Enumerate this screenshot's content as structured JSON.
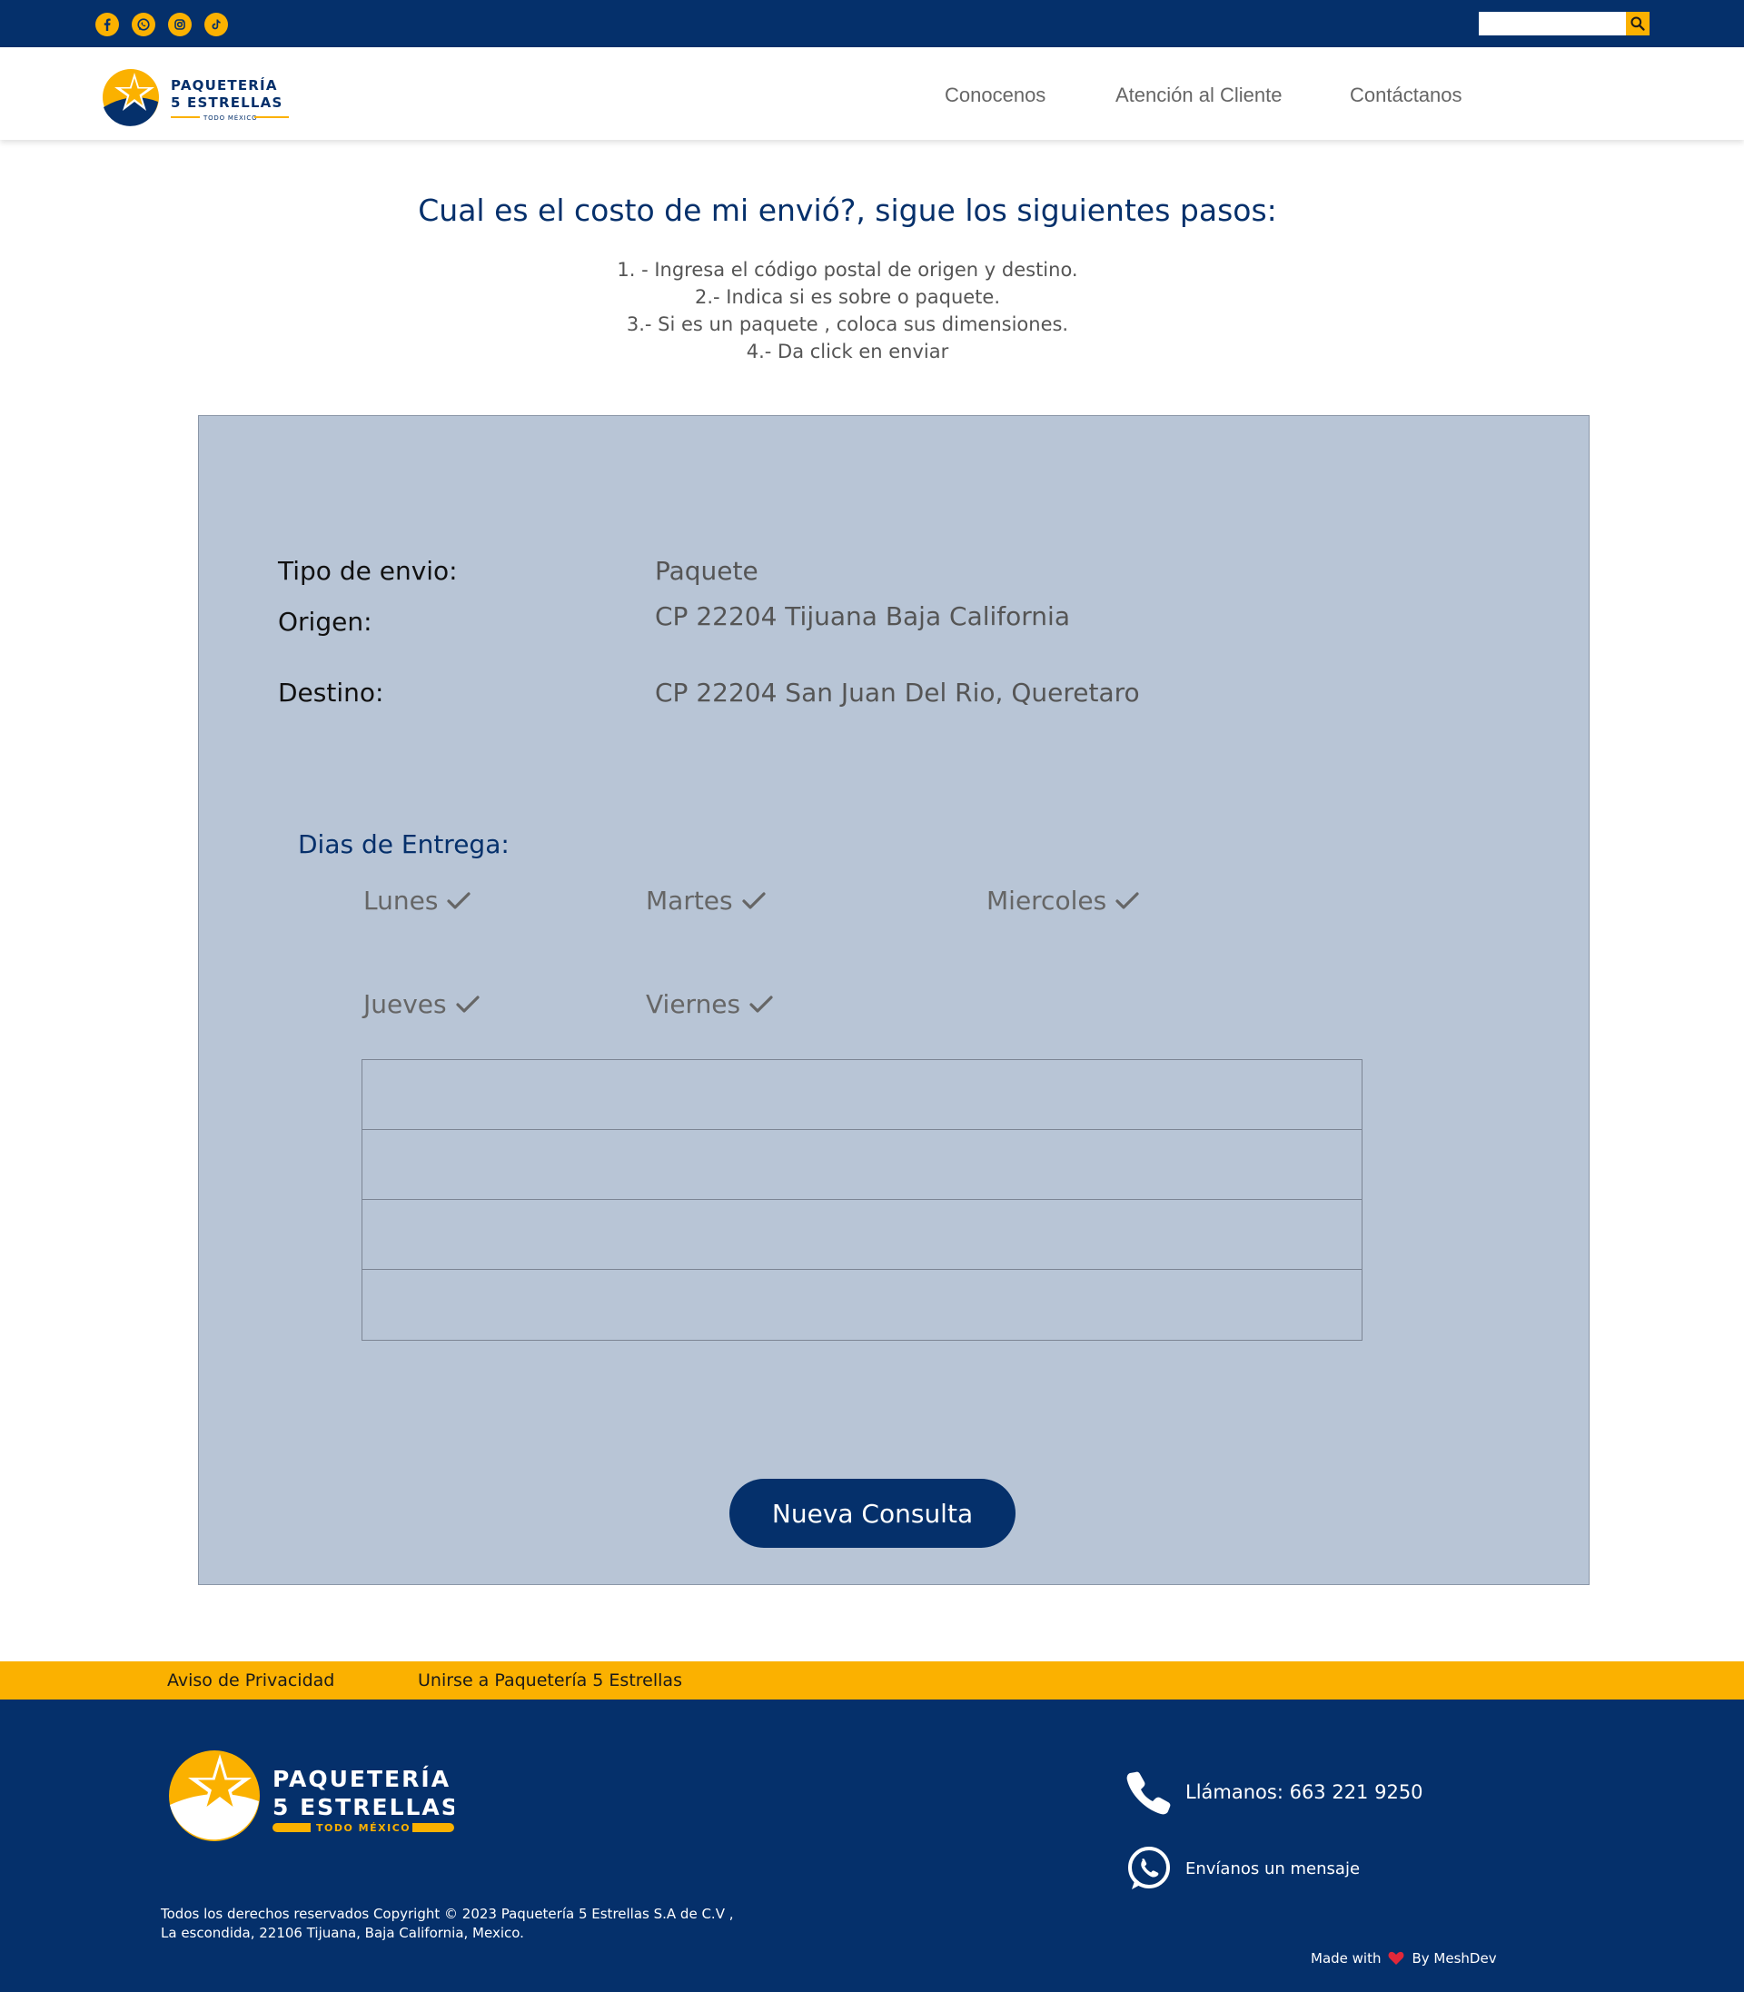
{
  "topbar": {
    "social_icons": [
      "facebook-icon",
      "whatsapp-icon",
      "instagram-icon",
      "tiktok-icon"
    ],
    "search": {
      "placeholder": "",
      "value": ""
    }
  },
  "brand": {
    "line1": "PAQUETERÍA",
    "line2": "5 ESTRELLAS",
    "tagline": "TODO MÉXICO"
  },
  "nav": {
    "items": [
      "Conocenos",
      "Atención al Cliente",
      "Contáctanos"
    ]
  },
  "intro": {
    "title": "Cual es el costo de mi envió?, sigue los siguientes pasos:",
    "steps": [
      "1. -  Ingresa el código postal de origen y destino.",
      "2.-  Indica si es sobre o paquete.",
      "3.-  Si es un paquete , coloca sus dimensiones.",
      "4.- Da click en enviar"
    ]
  },
  "result": {
    "fields": [
      {
        "label": "Tipo de envio:",
        "value": "Paquete"
      },
      {
        "label": "Origen:",
        "value": "CP 22204 Tijuana Baja California"
      },
      {
        "label": "Destino:",
        "value": "CP 22204 San Juan Del Rio, Queretaro"
      }
    ],
    "delivery_days_title": "Dias de Entrega:",
    "delivery_days": [
      "Lunes",
      "Martes",
      "Miercoles",
      "Jueves",
      "Viernes"
    ],
    "rows": [
      "",
      "",
      "",
      ""
    ],
    "new_query_label": "Nueva Consulta"
  },
  "footer": {
    "links": [
      "Aviso de Privacidad",
      "Unirse a Paquetería 5 Estrellas"
    ],
    "copyright_line1": "Todos los derechos reservados Copyright © 2023 Paquetería 5  Estrellas S.A de C.V ,",
    "copyright_line2": "La escondida, 22106 Tijuana, Baja California, Mexico.",
    "phone_label": "Llámanos: 663 221 9250",
    "message_label": "Envíanos un mensaje",
    "made_with": "Made with",
    "by": "By MeshDev"
  },
  "colors": {
    "navy": "#05306b",
    "gold": "#fbb100",
    "panel": "#b8c5d6"
  }
}
